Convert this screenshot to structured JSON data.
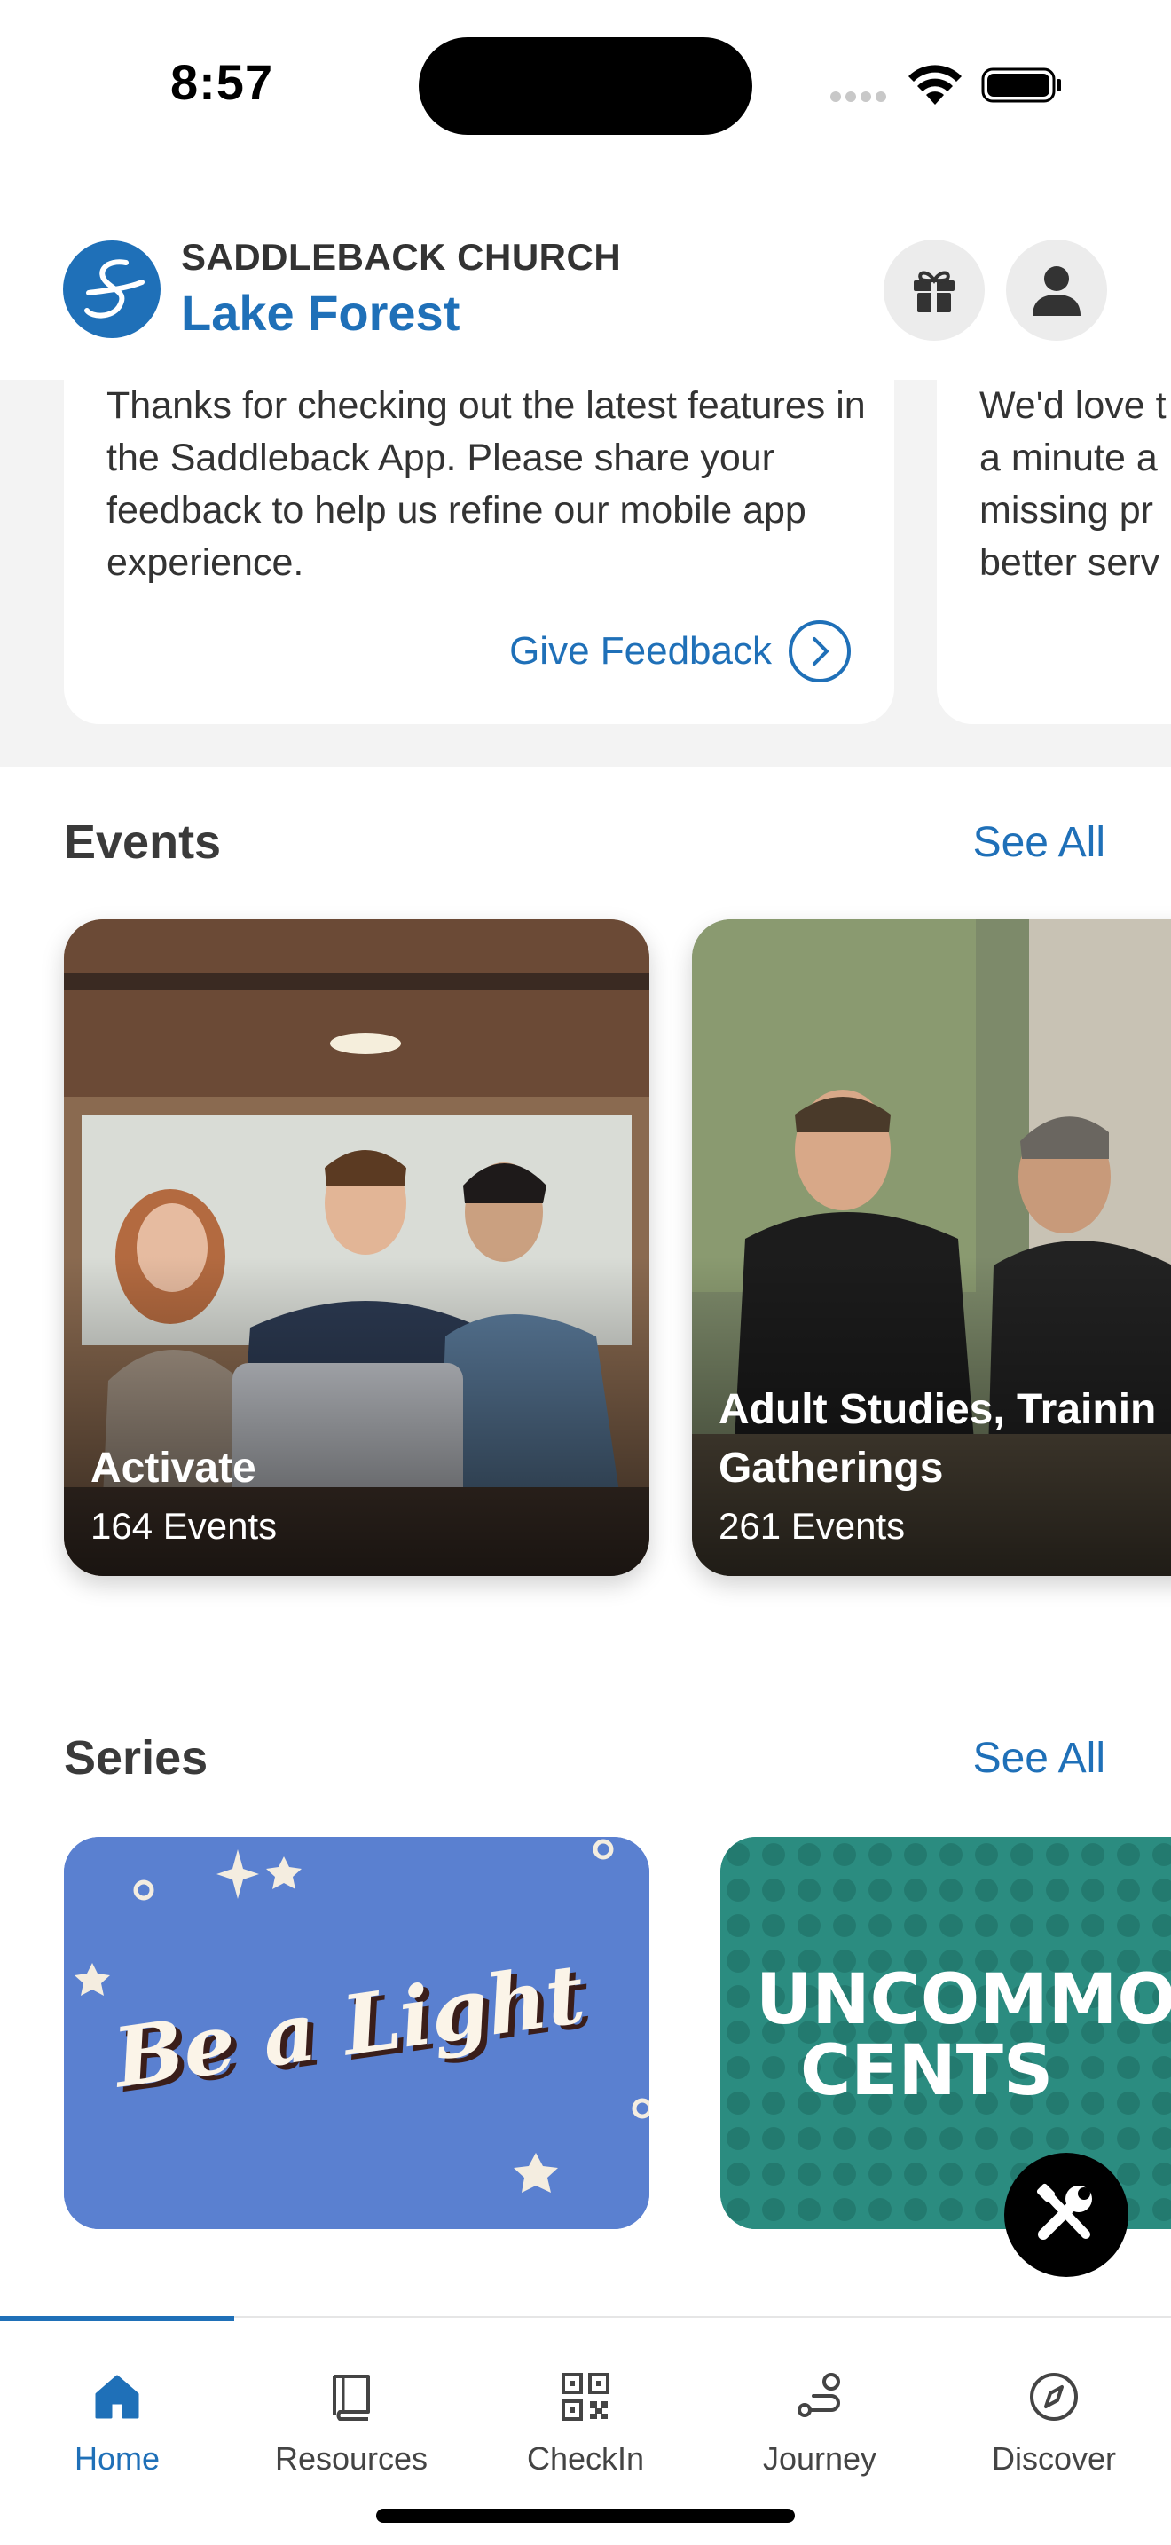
{
  "status_bar": {
    "time": "8:57"
  },
  "header": {
    "church_name": "SADDLEBACK CHURCH",
    "campus_name": "Lake Forest",
    "logo_icon": "saddleback-logo-icon",
    "gift_icon": "gift-icon",
    "profile_icon": "person-icon",
    "brand_color": "#1f70b8"
  },
  "feedback_cards": [
    {
      "text": "Thanks for checking out the latest features in the Saddleback App. Please share your feedback to help us refine our mobile app experience.",
      "link_label": "Give Feedback"
    },
    {
      "lines": [
        "We'd love t",
        "a minute a",
        "missing pr",
        "better serv"
      ]
    }
  ],
  "events": {
    "title": "Events",
    "see_all": "See All",
    "items": [
      {
        "title": "Activate",
        "count": "164 Events"
      },
      {
        "title": "Adult Studies, Training & Gatherings",
        "title_visible": "Adult Studies, Trainin",
        "title_line2": "Gatherings",
        "count": "261 Events"
      }
    ]
  },
  "series": {
    "title": "Series",
    "see_all": "See All",
    "items": [
      {
        "artwork_text": "Be a Light",
        "color": "#5a80d0"
      },
      {
        "artwork_text_line1": "UNCOMMON",
        "artwork_text_line2": "CENTS",
        "color": "#2b8c80"
      }
    ]
  },
  "fab": {
    "icon": "tools-icon"
  },
  "tab_bar": {
    "tabs": [
      {
        "label": "Home",
        "icon": "home-icon",
        "active": true
      },
      {
        "label": "Resources",
        "icon": "book-icon",
        "active": false
      },
      {
        "label": "CheckIn",
        "icon": "qr-code-icon",
        "active": false
      },
      {
        "label": "Journey",
        "icon": "route-icon",
        "active": false
      },
      {
        "label": "Discover",
        "icon": "compass-icon",
        "active": false
      }
    ]
  }
}
